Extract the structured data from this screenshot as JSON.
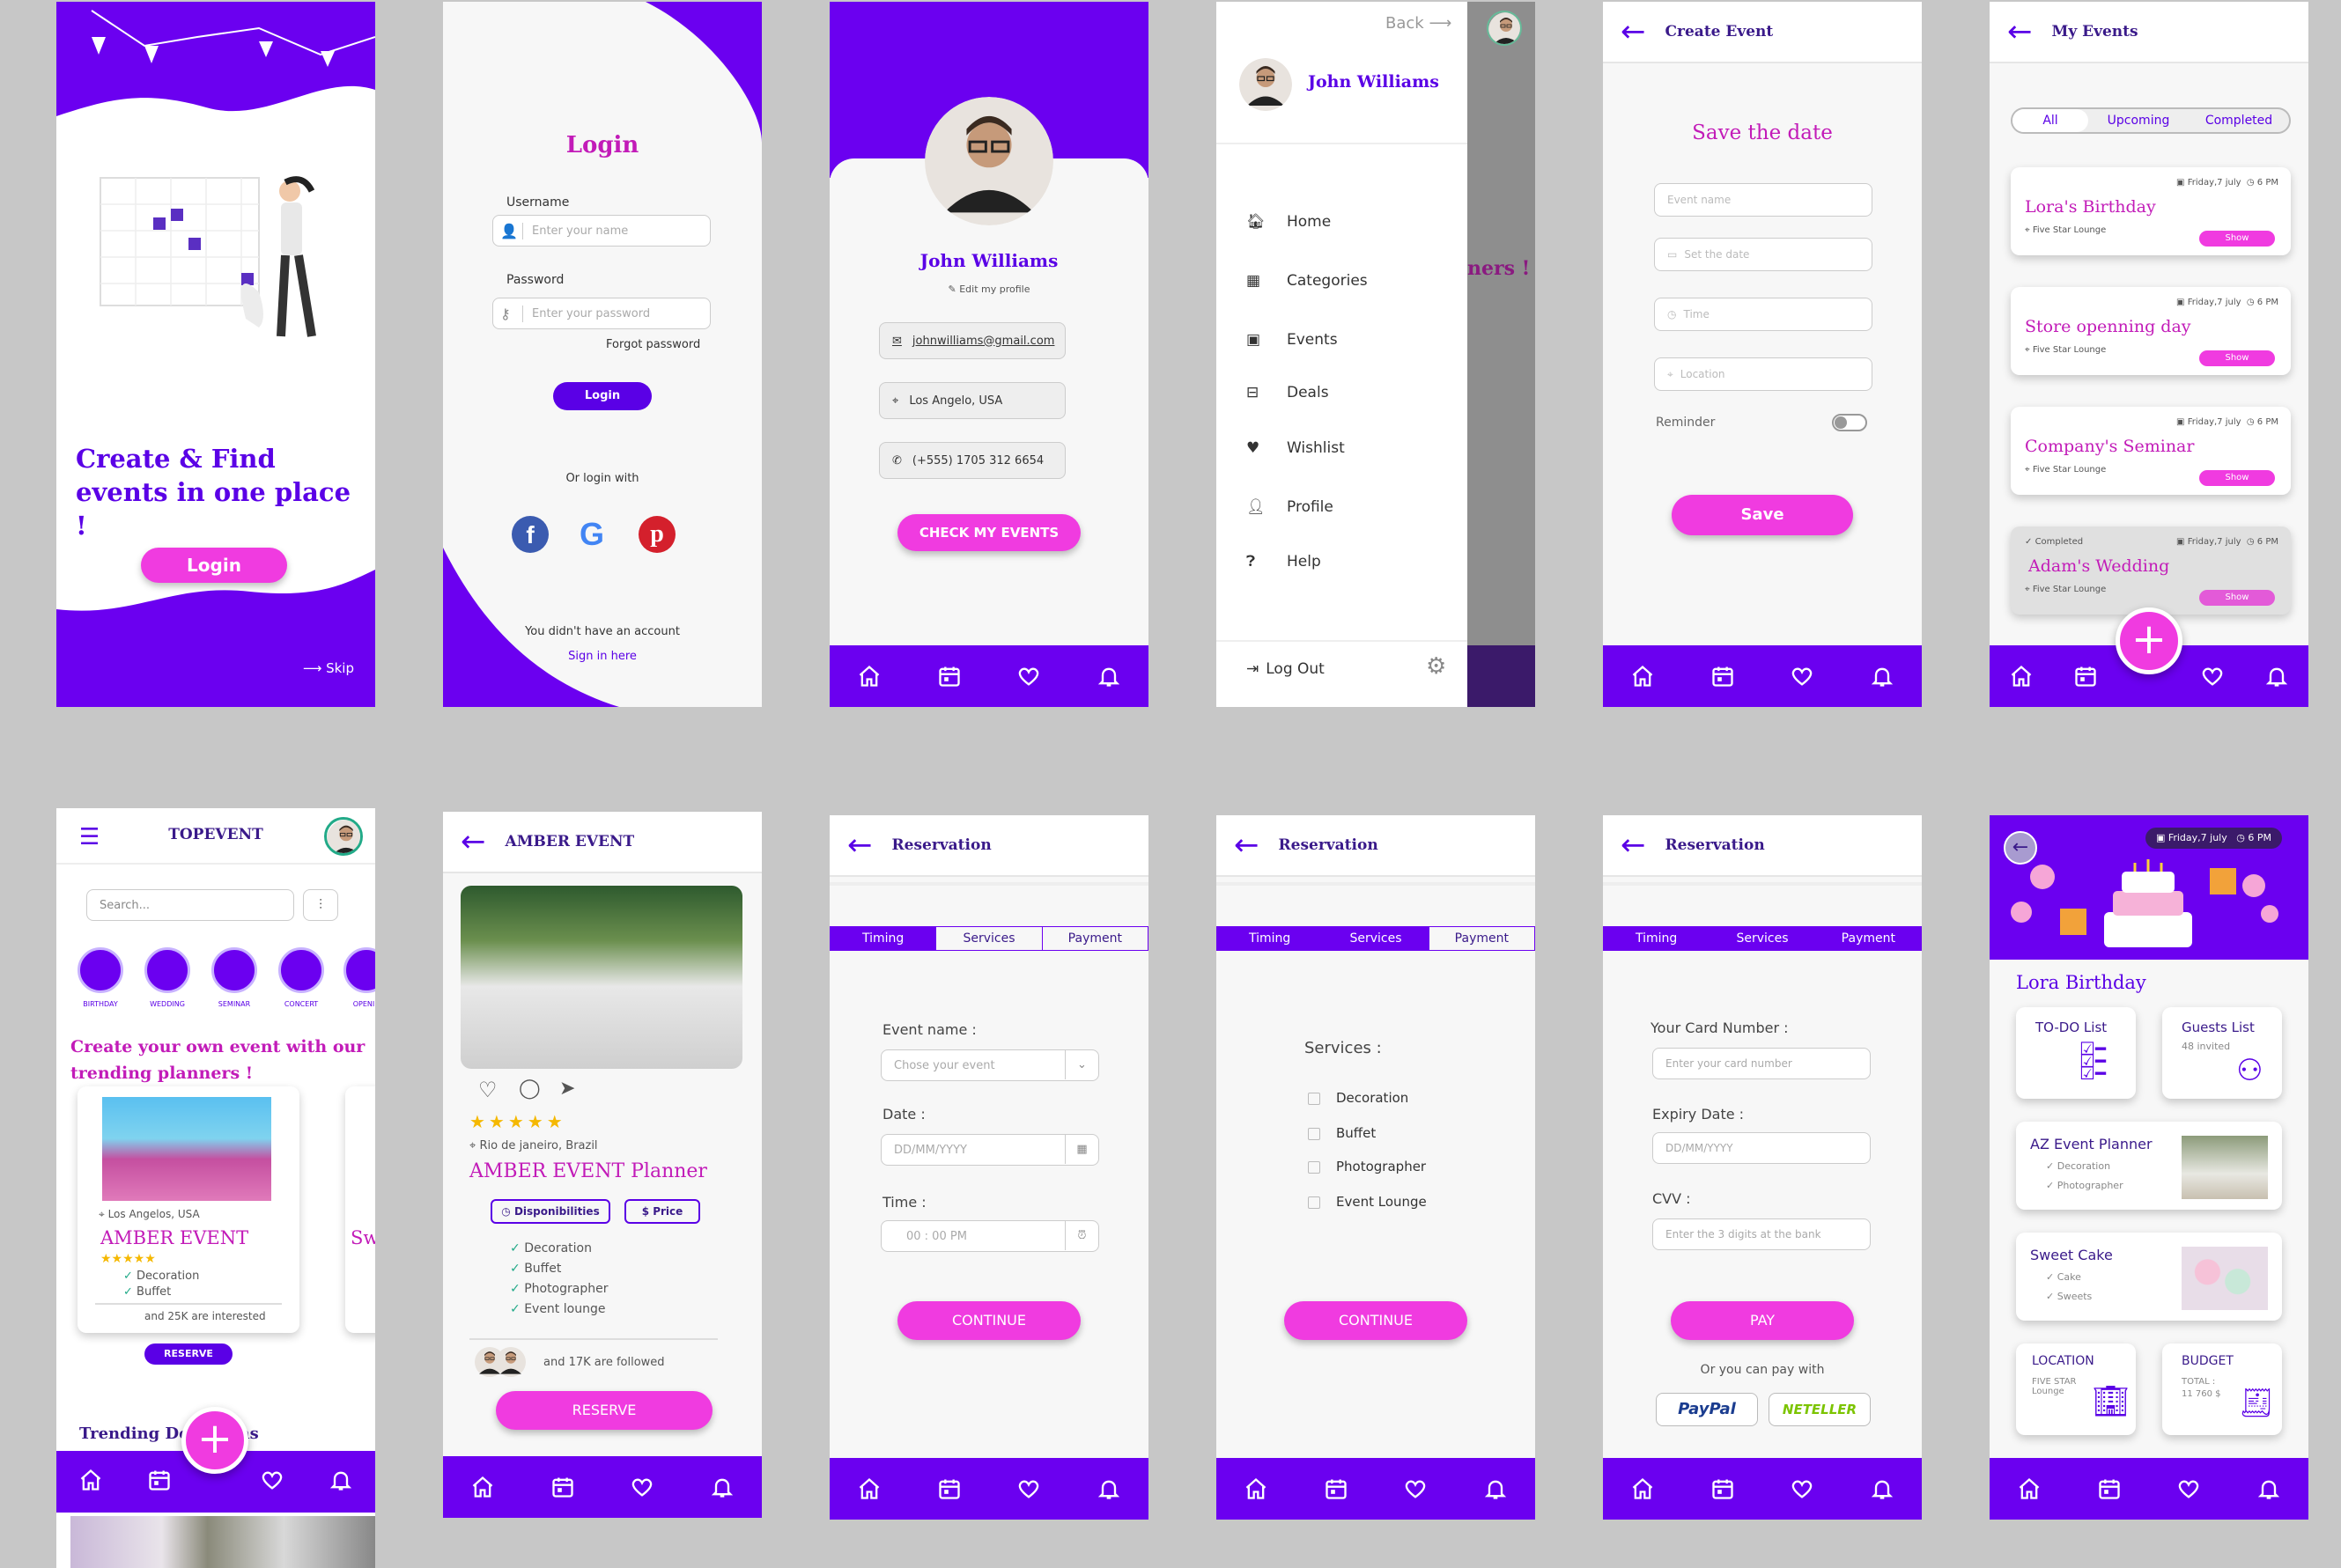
{
  "s1": {
    "title": "Create & Find events in one place !",
    "login": "Login",
    "skip": "Skip"
  },
  "s2": {
    "title": "Login",
    "username_label": "Username",
    "username_ph": "Enter your name",
    "password_label": "Password",
    "password_ph": "Enter your password",
    "forgot": "Forgot password",
    "login": "Login",
    "or_login": "Or login with",
    "no_account": "You didn't have an account",
    "sign_in": "Sign in here"
  },
  "s3": {
    "name": "John Williams",
    "edit": "Edit my profile",
    "email": "johnwilliams@gmail.com",
    "location": "Los Angelo, USA",
    "phone": "(+555) 1705 312 6654",
    "button": "CHECK MY EVENTS"
  },
  "s4": {
    "back": "Back",
    "name": "John Williams",
    "menu": [
      "Home",
      "Categories",
      "Events",
      "Deals",
      "Wishlist",
      "Profile",
      "Help"
    ],
    "logout": "Log Out",
    "bg_text": "ners !"
  },
  "s5": {
    "title": "Create Event",
    "heading": "Save the date",
    "fields": [
      "Event name",
      "Set the date",
      "Time",
      "Location"
    ],
    "reminder": "Reminder",
    "save": "Save"
  },
  "s6": {
    "title": "My Events",
    "tabs": [
      "All",
      "Upcoming",
      "Completed"
    ],
    "events": [
      {
        "name": "Lora's Birthday",
        "date": "Friday,7 july",
        "time": "6 PM",
        "place": "Five Star Lounge",
        "show": "Show",
        "completed": ""
      },
      {
        "name": "Store openning day",
        "date": "Friday,7 july",
        "time": "6 PM",
        "place": "Five Star Lounge",
        "show": "Show",
        "completed": ""
      },
      {
        "name": "Company's Seminar",
        "date": "Friday,7 july",
        "time": "6 PM",
        "place": "Five Star Lounge",
        "show": "Show",
        "completed": ""
      },
      {
        "name": "Adam's Wedding",
        "date": "Friday,7 july",
        "time": "6 PM",
        "place": "Five Star Lounge",
        "show": "Show",
        "completed": "Completed"
      }
    ]
  },
  "s7": {
    "brand": "TOPEVENT",
    "search": "Search...",
    "cats": [
      "BIRTHDAY",
      "WEDDING",
      "SEMINAR",
      "CONCERT",
      "OPENIN"
    ],
    "heading": "Create your own event with our trending planners !",
    "loc": "Los Angelos, USA",
    "planner": "AMBER EVENT",
    "services": [
      "Decoration",
      "Buffet"
    ],
    "interested": "and 25K are interested",
    "reserve": "RESERVE",
    "trending": "Trending De",
    "trending_end": "ns",
    "peek": "Sw"
  },
  "s8": {
    "title": "AMBER EVENT",
    "loc": "Rio de janeiro, Brazil",
    "name": "AMBER EVENT Planner",
    "btn1": "Disponibilities",
    "btn2": "Price",
    "services": [
      "Decoration",
      "Buffet",
      "Photographer",
      "Event lounge"
    ],
    "followed": "and 17K are followed",
    "reserve": "RESERVE",
    "stars": "★★★★★"
  },
  "s9": {
    "title": "Reservation",
    "tabs": [
      "Timing",
      "Services",
      "Payment"
    ],
    "event_label": "Event name :",
    "event_ph": "Chose your event",
    "date_label": "Date :",
    "date_ph": "DD/MM/YYYY",
    "time_label": "Time :",
    "time_ph": "00 : 00 PM",
    "continue": "CONTINUE"
  },
  "s10": {
    "title": "Reservation",
    "tabs": [
      "Timing",
      "Services",
      "Payment"
    ],
    "services_label": "Services :",
    "services": [
      "Decoration",
      "Buffet",
      "Photographer",
      "Event Lounge"
    ],
    "continue": "CONTINUE"
  },
  "s11": {
    "title": "Reservation",
    "tabs": [
      "Timing",
      "Services",
      "Payment"
    ],
    "card_label": "Your Card Number :",
    "card_ph": "Enter your card number",
    "expiry_label": "Expiry Date :",
    "expiry_ph": "DD/MM/YYYY",
    "cvv_label": "CVV :",
    "cvv_ph": "Enter the 3 digits at the bank",
    "pay": "PAY",
    "or_pay": "Or you can pay with",
    "paypal": "PayPal",
    "neteller": "NETELLER"
  },
  "s12": {
    "date": "Friday,7 july",
    "time": "6 PM",
    "title": "Lora Birthday",
    "todo": "TO-DO List",
    "guests": "Guests List",
    "invited": "48 invited",
    "az": "AZ Event Planner",
    "az_items": [
      "Decoration",
      "Photographer"
    ],
    "cake": "Sweet Cake",
    "cake_items": [
      "Cake",
      "Sweets"
    ],
    "location": "LOCATION",
    "location_val": "FIVE STAR Lounge",
    "budget": "BUDGET",
    "budget_total": "TOTAL :",
    "budget_val": "11 760 $"
  },
  "colors": {
    "primary": "#6b00f0",
    "accent": "#f03be0",
    "title": "#c21bb8"
  }
}
